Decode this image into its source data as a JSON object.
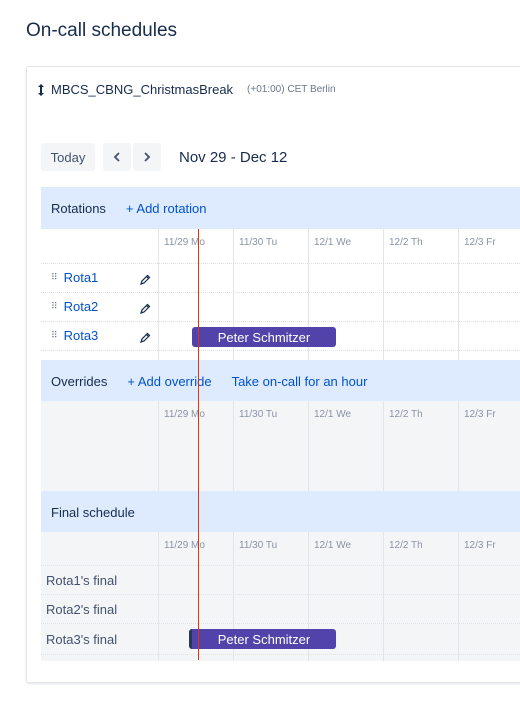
{
  "page": {
    "title": "On-call schedules"
  },
  "schedule": {
    "name": "MBCS_CBNG_ChristmasBreak",
    "timezone": "(+01:00) CET Berlin"
  },
  "nav": {
    "today_label": "Today",
    "prev_label": "‹",
    "next_label": "›",
    "range": "Nov 29 - Dec 12"
  },
  "days": [
    "11/29 Mo",
    "11/30 Tu",
    "12/1 We",
    "12/2 Th",
    "12/3 Fr"
  ],
  "rotations": {
    "title": "Rotations",
    "add_label": "+ Add rotation",
    "items": [
      {
        "label": "Rota1"
      },
      {
        "label": "Rota2"
      },
      {
        "label": "Rota3",
        "assignee": "Peter Schmitzer"
      }
    ]
  },
  "overrides": {
    "title": "Overrides",
    "add_label": "+ Add override",
    "take_label": "Take on-call for an hour"
  },
  "final": {
    "title": "Final schedule",
    "items": [
      {
        "label": "Rota1's final"
      },
      {
        "label": "Rota2's final"
      },
      {
        "label": "Rota3's final",
        "assignee": "Peter Schmitzer"
      }
    ]
  },
  "colors": {
    "accent": "#0052cc",
    "section_bg": "#deebff",
    "bar": "#5243aa",
    "now_line": "#de350b"
  },
  "icons": {
    "drag": "drag-handle-icon",
    "edit": "pencil-icon",
    "grip": "grip-icon"
  }
}
